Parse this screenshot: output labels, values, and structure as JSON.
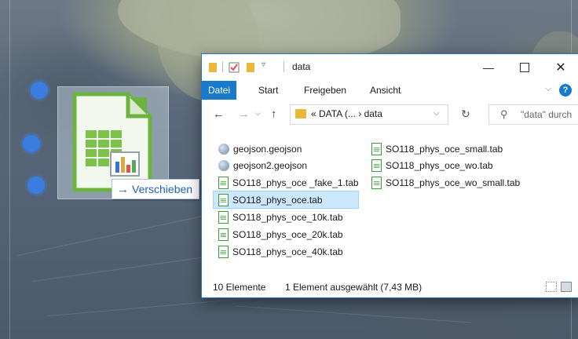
{
  "window": {
    "title": "data",
    "controls": [
      "minimize-icon",
      "maximize-icon",
      "close-icon"
    ]
  },
  "ribbon": {
    "tabs": [
      "Datei",
      "Start",
      "Freigeben",
      "Ansicht"
    ],
    "help": "?"
  },
  "address": {
    "path": "« DATA (... › data",
    "search_placeholder": "\"data\" durch"
  },
  "files": {
    "col1": [
      {
        "name": "geojson.geojson",
        "icon": "geojson-file-icon"
      },
      {
        "name": "geojson2.geojson",
        "icon": "geojson-file-icon"
      },
      {
        "name": "SO118_phys_oce _fake_1.tab",
        "icon": "spreadsheet-file-icon"
      },
      {
        "name": "SO118_phys_oce.tab",
        "icon": "spreadsheet-file-icon",
        "selected": true
      },
      {
        "name": "SO118_phys_oce_10k.tab",
        "icon": "spreadsheet-file-icon"
      },
      {
        "name": "SO118_phys_oce_20k.tab",
        "icon": "spreadsheet-file-icon"
      },
      {
        "name": "SO118_phys_oce_40k.tab",
        "icon": "spreadsheet-file-icon"
      }
    ],
    "col2": [
      {
        "name": "SO118_phys_oce_small.tab",
        "icon": "spreadsheet-file-icon"
      },
      {
        "name": "SO118_phys_oce_wo.tab",
        "icon": "spreadsheet-file-icon"
      },
      {
        "name": "SO118_phys_oce_wo_small.tab",
        "icon": "spreadsheet-file-icon"
      }
    ]
  },
  "status": {
    "count": "10 Elemente",
    "selection": "1 Element ausgewählt (7,43 MB)"
  },
  "drag": {
    "tooltip": "Verschieben",
    "icon": "libreoffice-calc-icon"
  },
  "colors": {
    "accent": "#1979ca",
    "selection": "#cce8ff",
    "marker": "#3b7dde"
  }
}
